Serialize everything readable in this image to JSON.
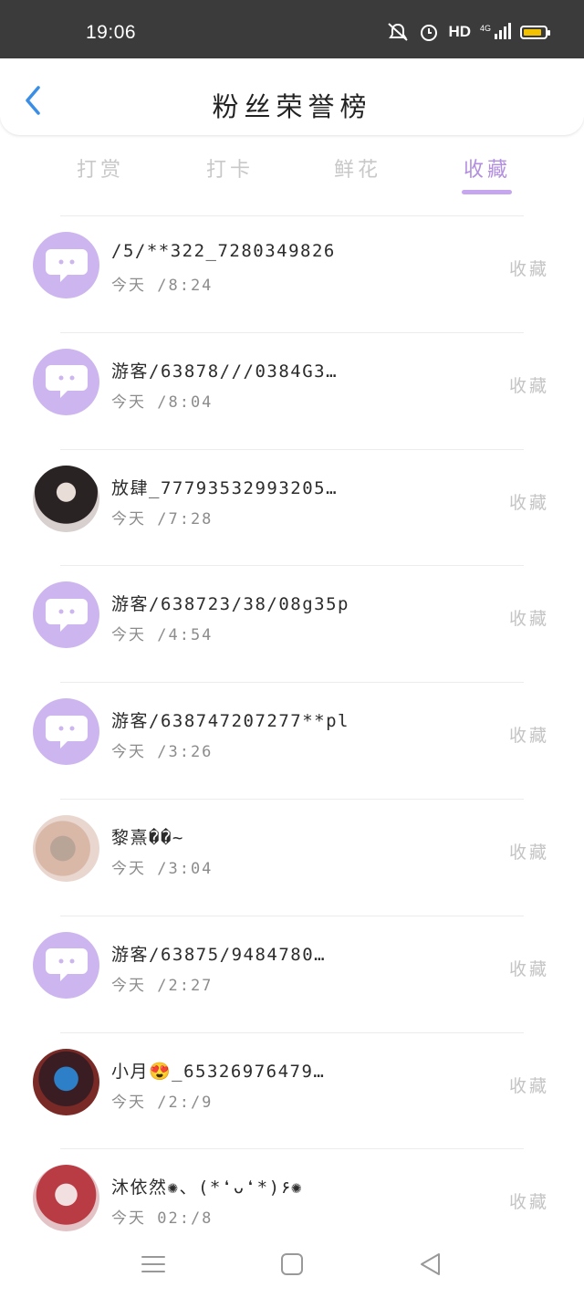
{
  "status_bar": {
    "time": "19:06",
    "network": "HD",
    "signal": "4G",
    "battery_level": 0.85,
    "battery_color": "#f2c200"
  },
  "header": {
    "title": "粉丝荣誉榜",
    "back_icon": "chevron-left-icon",
    "accent_color": "#3a8ee6"
  },
  "tabs": {
    "items": [
      {
        "label": "打赏"
      },
      {
        "label": "打卡"
      },
      {
        "label": "鲜花"
      },
      {
        "label": "收藏"
      }
    ],
    "active": "收藏",
    "active_color": "#b38fe0"
  },
  "list": {
    "action_label": "收藏",
    "items": [
      {
        "name": "/5/**322_7280349826",
        "time": "今天 /8:24",
        "avatar": "default-avatar-icon"
      },
      {
        "name": "游客/63878///0384G3…",
        "time": "今天 /8:04",
        "avatar": "default-avatar-icon"
      },
      {
        "name": "放肆_77793532993205…",
        "time": "今天 /7:28",
        "avatar": "user-photo"
      },
      {
        "name": "游客/638723/38/08g35p",
        "time": "今天 /4:54",
        "avatar": "default-avatar-icon"
      },
      {
        "name": "游客/638747207277**pl",
        "time": "今天 /3:26",
        "avatar": "default-avatar-icon"
      },
      {
        "name": "黎熹��~",
        "time": "今天 /3:04",
        "avatar": "user-photo"
      },
      {
        "name": "游客/63875/9484780…",
        "time": "今天 /2:27",
        "avatar": "default-avatar-icon"
      },
      {
        "name": "小月😍_65326976479…",
        "time": "今天 /2:/9",
        "avatar": "user-photo"
      },
      {
        "name": "沐依然✺、(*❛ᴗ❛*)۶✺",
        "time": "今天 02:/8",
        "avatar": "user-photo"
      }
    ]
  },
  "nav_bar": {
    "menu_icon": "menu-icon",
    "home_icon": "home-square-icon",
    "back_icon": "back-triangle-icon"
  }
}
